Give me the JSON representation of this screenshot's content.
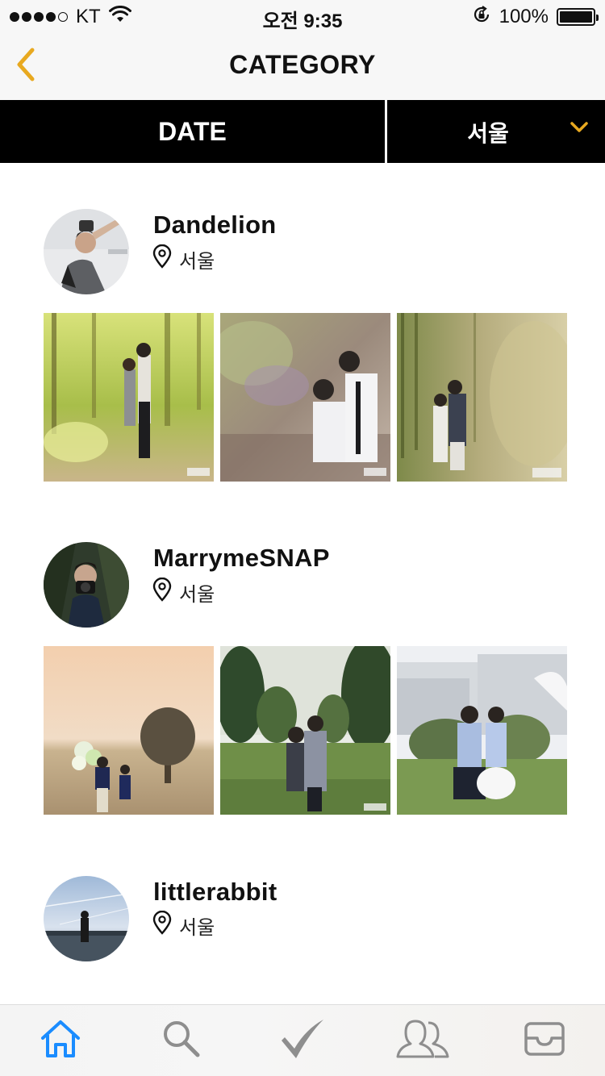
{
  "status_bar": {
    "carrier": "KT",
    "time": "오전 9:35",
    "battery": "100%"
  },
  "nav": {
    "title": "CATEGORY",
    "accent_color": "#e8a920"
  },
  "filter": {
    "sort_label": "DATE",
    "region_selected": "서울"
  },
  "photographers": [
    {
      "name": "Dandelion",
      "location": "서울"
    },
    {
      "name": "MarrymeSNAP",
      "location": "서울"
    },
    {
      "name": "littlerabbit",
      "location": "서울"
    }
  ],
  "tab_bar": {
    "tabs": [
      {
        "icon": "home-icon",
        "active": true
      },
      {
        "icon": "search-icon",
        "active": false
      },
      {
        "icon": "check-icon",
        "active": false
      },
      {
        "icon": "people-icon",
        "active": false
      },
      {
        "icon": "inbox-icon",
        "active": false
      }
    ],
    "active_color": "#1a8cff",
    "inactive_color": "#8e8e8e"
  }
}
